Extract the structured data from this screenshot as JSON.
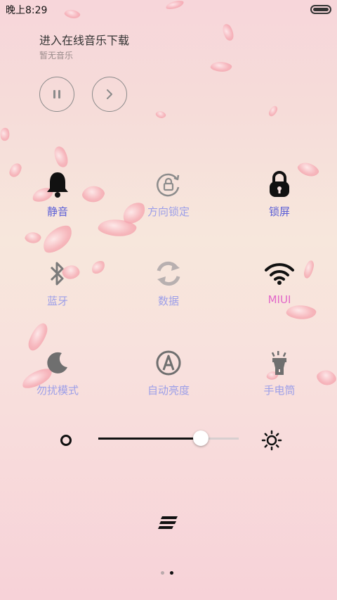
{
  "status_bar": {
    "time": "晚上8:29",
    "battery_level": 1.0
  },
  "music": {
    "title": "进入在线音乐下载",
    "subtitle": "暂无音乐",
    "pause_icon": "pause-icon",
    "next_icon": "chevron-right-icon"
  },
  "toggles": [
    {
      "label": "静音",
      "icon": "bell-icon",
      "state": "on"
    },
    {
      "label": "方向锁定",
      "icon": "rotation-lock-icon",
      "state": "off"
    },
    {
      "label": "锁屏",
      "icon": "lock-icon",
      "state": "on"
    },
    {
      "label": "蓝牙",
      "icon": "bluetooth-icon",
      "state": "off"
    },
    {
      "label": "数据",
      "icon": "mobile-data-icon",
      "state": "off"
    },
    {
      "label": "MIUI",
      "icon": "wifi-icon",
      "state": "on"
    },
    {
      "label": "勿扰模式",
      "icon": "moon-icon",
      "state": "off"
    },
    {
      "label": "自动亮度",
      "icon": "auto-brightness-icon",
      "state": "off"
    },
    {
      "label": "手电筒",
      "icon": "flashlight-icon",
      "state": "off"
    }
  ],
  "brightness": {
    "level": 0.73
  },
  "pages": {
    "count": 2,
    "active": 2
  },
  "colors": {
    "label": "#5b5fd6",
    "label_off": "#9d9fe8",
    "label_accent": "#e267c8"
  }
}
